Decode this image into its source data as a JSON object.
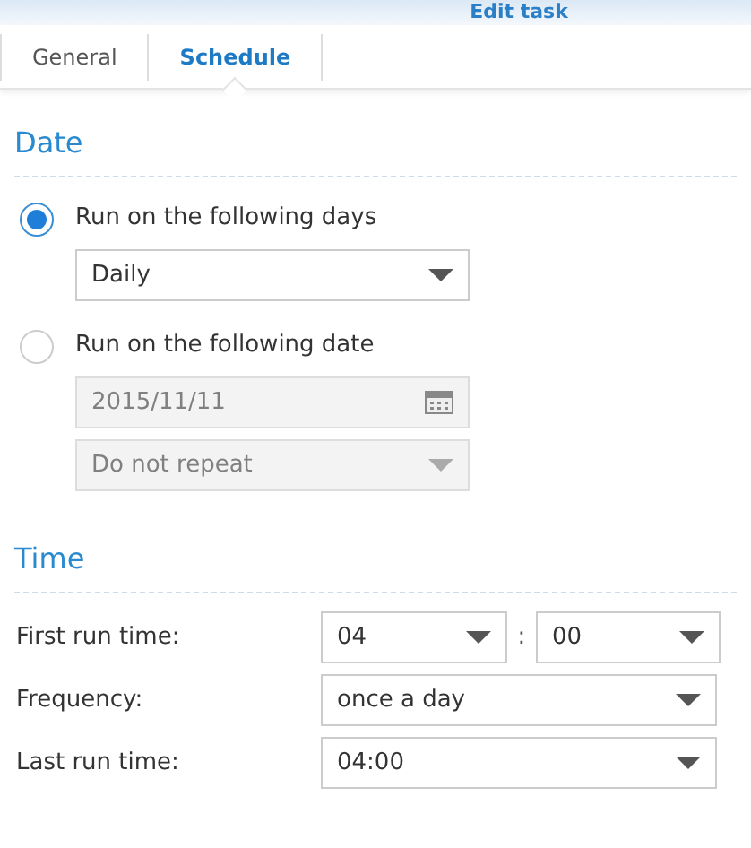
{
  "window": {
    "title": "Edit task"
  },
  "tabs": [
    {
      "label": "General",
      "selected": false
    },
    {
      "label": "Schedule",
      "selected": true
    }
  ],
  "date_section": {
    "heading": "Date",
    "options": [
      {
        "label": "Run on the following days",
        "selected": true,
        "fields": [
          {
            "kind": "select",
            "value": "Daily",
            "disabled": false
          }
        ]
      },
      {
        "label": "Run on the following date",
        "selected": false,
        "fields": [
          {
            "kind": "date",
            "value": "2015/11/11",
            "disabled": true
          },
          {
            "kind": "select",
            "value": "Do not repeat",
            "disabled": true
          }
        ]
      }
    ]
  },
  "time_section": {
    "heading": "Time",
    "rows": [
      {
        "label": "First run time:",
        "kind": "hour_minute",
        "hour": "04",
        "separator": ":",
        "minute": "00"
      },
      {
        "label": "Frequency:",
        "kind": "select",
        "value": "once a day"
      },
      {
        "label": "Last run time:",
        "kind": "select",
        "value": "04:00"
      }
    ]
  }
}
